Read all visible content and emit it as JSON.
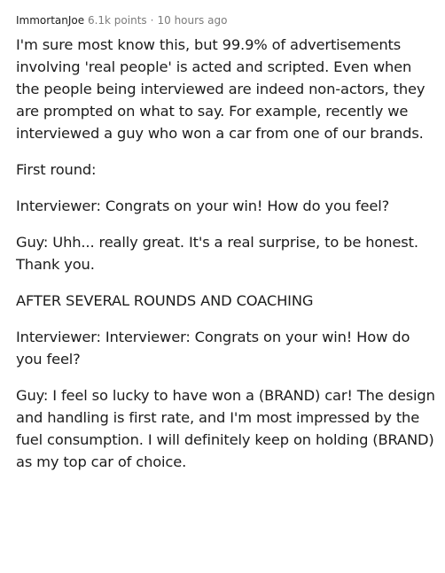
{
  "comment": {
    "author": "ImmortanJoe",
    "points": "6.1k points",
    "separator": "·",
    "time": "10 hours ago",
    "paragraphs": [
      "I'm sure most know this, but 99.9% of advertisements involving 'real people' is acted and scripted. Even when the people being interviewed are indeed non-actors, they are prompted on what to say. For example, recently we interviewed a guy who won a car from one of our brands.",
      "First round:",
      "Interviewer: Congrats on your win! How do you feel?",
      "Guy: Uhh... really great. It's a real surprise, to be honest. Thank you.",
      "AFTER SEVERAL ROUNDS AND COACHING",
      "Interviewer: Interviewer: Congrats on your win! How do you feel?",
      "Guy: I feel so lucky to have won a (BRAND) car! The design and handling is first rate, and I'm most impressed by the fuel consumption. I will definitely keep on holding (BRAND) as my top car of choice."
    ]
  }
}
